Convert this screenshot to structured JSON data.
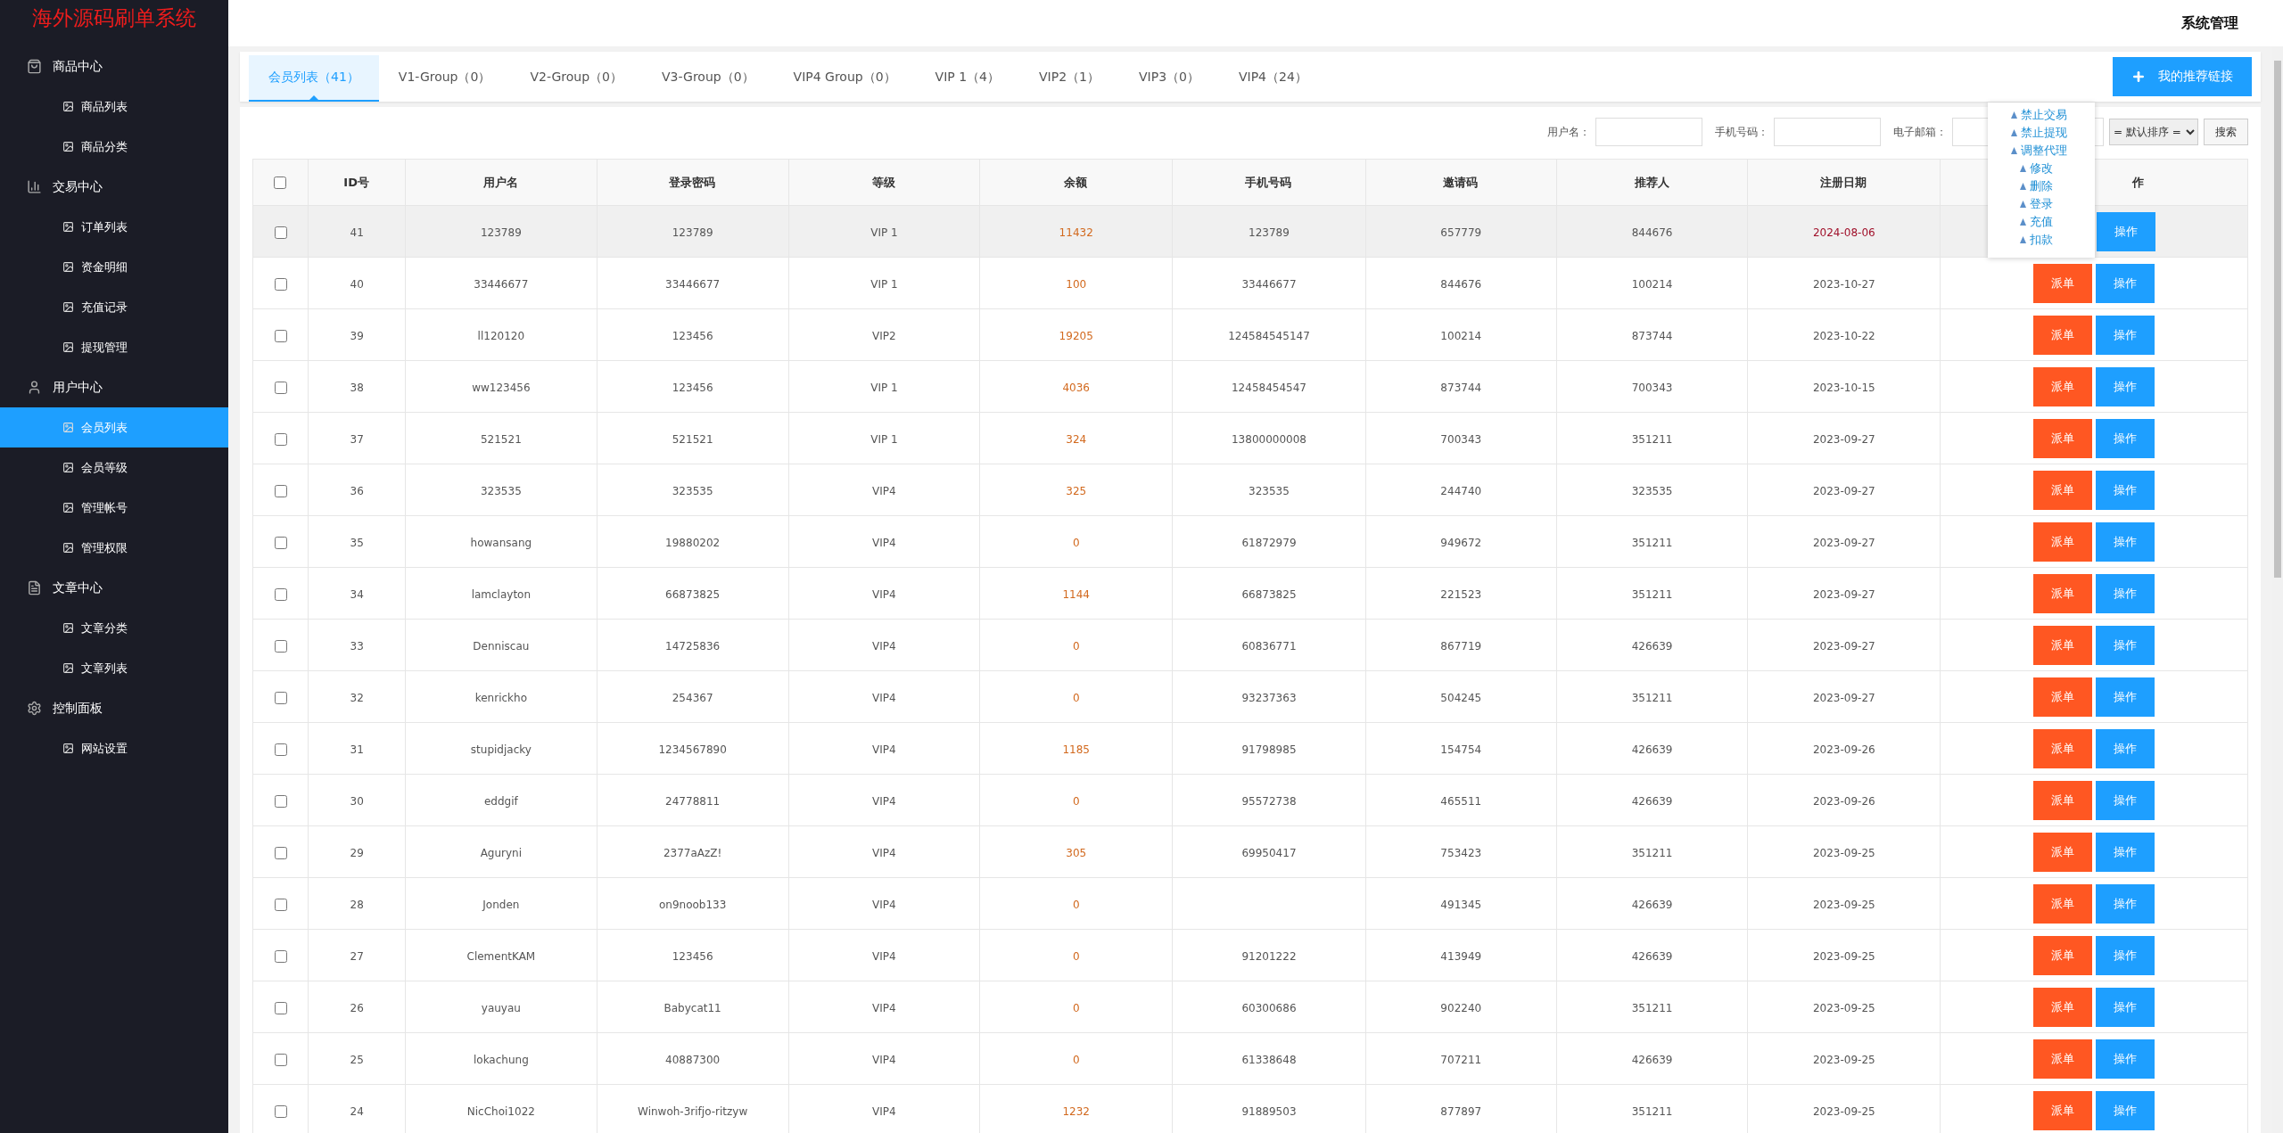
{
  "app_title": "海外源码刷单系统",
  "header": {
    "title": "系统管理"
  },
  "sidebar": {
    "groups": [
      {
        "label": "商品中心",
        "items": [
          {
            "label": "商品列表",
            "selected": false
          },
          {
            "label": "商品分类",
            "selected": false
          }
        ]
      },
      {
        "label": "交易中心",
        "items": [
          {
            "label": "订单列表",
            "selected": false
          },
          {
            "label": "资金明细",
            "selected": false
          },
          {
            "label": "充值记录",
            "selected": false
          },
          {
            "label": "提现管理",
            "selected": false
          }
        ]
      },
      {
        "label": "用户中心",
        "items": [
          {
            "label": "会员列表",
            "selected": true
          },
          {
            "label": "会员等级",
            "selected": false
          },
          {
            "label": "管理帐号",
            "selected": false
          },
          {
            "label": "管理权限",
            "selected": false
          }
        ]
      },
      {
        "label": "文章中心",
        "items": [
          {
            "label": "文章分类",
            "selected": false
          },
          {
            "label": "文章列表",
            "selected": false
          }
        ]
      },
      {
        "label": "控制面板",
        "items": [
          {
            "label": "网站设置",
            "selected": false
          }
        ]
      }
    ]
  },
  "tabs": [
    {
      "label": "会员列表（41）",
      "selected": true
    },
    {
      "label": "V1-Group（0）",
      "selected": false
    },
    {
      "label": "V2-Group（0）",
      "selected": false
    },
    {
      "label": "V3-Group（0）",
      "selected": false
    },
    {
      "label": "VIP4 Group（0）",
      "selected": false
    },
    {
      "label": "VIP 1（4）",
      "selected": false
    },
    {
      "label": "VIP2（1）",
      "selected": false
    },
    {
      "label": "VIP3（0）",
      "selected": false
    },
    {
      "label": "VIP4（24）",
      "selected": false
    }
  ],
  "referral_button": {
    "label": "我的推荐链接"
  },
  "filters": [
    {
      "kind": "text",
      "label": "用户名："
    },
    {
      "kind": "text",
      "label": "手机号码："
    },
    {
      "kind": "text",
      "label": "电子邮箱："
    },
    {
      "kind": "text"
    },
    {
      "kind": "select",
      "value": "= 默认排序 ="
    },
    {
      "kind": "button",
      "label": "搜索"
    }
  ],
  "table": {
    "select_all": {
      "checked": false
    },
    "columns": [
      "ID号",
      "用户名",
      "登录密码",
      "等级",
      "余额",
      "手机号码",
      "邀请码",
      "推荐人",
      "注册日期",
      "作"
    ],
    "rows": [
      {
        "checked": false,
        "hovered": true,
        "flagged": true,
        "cells": [
          "41",
          "123789",
          "123789",
          "VIP 1",
          "11432",
          "123789",
          "657779",
          "844676",
          "2024-08-06"
        ],
        "actions": [
          {
            "kind": "operate",
            "label": "操作"
          }
        ]
      },
      {
        "checked": false,
        "hovered": false,
        "flagged": false,
        "cells": [
          "40",
          "33446677",
          "33446677",
          "VIP 1",
          "100",
          "33446677",
          "844676",
          "100214",
          "2023-10-27"
        ],
        "actions": [
          {
            "kind": "dispatch",
            "label": "派单"
          },
          {
            "kind": "operate",
            "label": "操作"
          }
        ]
      },
      {
        "checked": false,
        "hovered": false,
        "flagged": false,
        "cells": [
          "39",
          "ll120120",
          "123456",
          "VIP2",
          "19205",
          "124584545147",
          "100214",
          "873744",
          "2023-10-22"
        ],
        "actions": [
          {
            "kind": "dispatch",
            "label": "派单"
          },
          {
            "kind": "operate",
            "label": "操作"
          }
        ]
      },
      {
        "checked": false,
        "hovered": false,
        "flagged": false,
        "cells": [
          "38",
          "ww123456",
          "123456",
          "VIP 1",
          "4036",
          "12458454547",
          "873744",
          "700343",
          "2023-10-15"
        ],
        "actions": [
          {
            "kind": "dispatch",
            "label": "派单"
          },
          {
            "kind": "operate",
            "label": "操作"
          }
        ]
      },
      {
        "checked": false,
        "hovered": false,
        "flagged": false,
        "cells": [
          "37",
          "521521",
          "521521",
          "VIP 1",
          "324",
          "13800000008",
          "700343",
          "351211",
          "2023-09-27"
        ],
        "actions": [
          {
            "kind": "dispatch",
            "label": "派单"
          },
          {
            "kind": "operate",
            "label": "操作"
          }
        ]
      },
      {
        "checked": false,
        "hovered": false,
        "flagged": false,
        "cells": [
          "36",
          "323535",
          "323535",
          "VIP4",
          "325",
          "323535",
          "244740",
          "323535",
          "2023-09-27"
        ],
        "actions": [
          {
            "kind": "dispatch",
            "label": "派单"
          },
          {
            "kind": "operate",
            "label": "操作"
          }
        ]
      },
      {
        "checked": false,
        "hovered": false,
        "flagged": false,
        "cells": [
          "35",
          "howansang",
          "19880202",
          "VIP4",
          "0",
          "61872979",
          "949672",
          "351211",
          "2023-09-27"
        ],
        "actions": [
          {
            "kind": "dispatch",
            "label": "派单"
          },
          {
            "kind": "operate",
            "label": "操作"
          }
        ]
      },
      {
        "checked": false,
        "hovered": false,
        "flagged": false,
        "cells": [
          "34",
          "lamclayton",
          "66873825",
          "VIP4",
          "1144",
          "66873825",
          "221523",
          "351211",
          "2023-09-27"
        ],
        "actions": [
          {
            "kind": "dispatch",
            "label": "派单"
          },
          {
            "kind": "operate",
            "label": "操作"
          }
        ]
      },
      {
        "checked": false,
        "hovered": false,
        "flagged": false,
        "cells": [
          "33",
          "Denniscau",
          "14725836",
          "VIP4",
          "0",
          "60836771",
          "867719",
          "426639",
          "2023-09-27"
        ],
        "actions": [
          {
            "kind": "dispatch",
            "label": "派单"
          },
          {
            "kind": "operate",
            "label": "操作"
          }
        ]
      },
      {
        "checked": false,
        "hovered": false,
        "flagged": false,
        "cells": [
          "32",
          "kenrickho",
          "254367",
          "VIP4",
          "0",
          "93237363",
          "504245",
          "351211",
          "2023-09-27"
        ],
        "actions": [
          {
            "kind": "dispatch",
            "label": "派单"
          },
          {
            "kind": "operate",
            "label": "操作"
          }
        ]
      },
      {
        "checked": false,
        "hovered": false,
        "flagged": false,
        "cells": [
          "31",
          "stupidjacky",
          "1234567890",
          "VIP4",
          "1185",
          "91798985",
          "154754",
          "426639",
          "2023-09-26"
        ],
        "actions": [
          {
            "kind": "dispatch",
            "label": "派单"
          },
          {
            "kind": "operate",
            "label": "操作"
          }
        ]
      },
      {
        "checked": false,
        "hovered": false,
        "flagged": false,
        "cells": [
          "30",
          "eddgif",
          "24778811",
          "VIP4",
          "0",
          "95572738",
          "465511",
          "426639",
          "2023-09-26"
        ],
        "actions": [
          {
            "kind": "dispatch",
            "label": "派单"
          },
          {
            "kind": "operate",
            "label": "操作"
          }
        ]
      },
      {
        "checked": false,
        "hovered": false,
        "flagged": false,
        "cells": [
          "29",
          "Aguryni",
          "2377aAzZ!",
          "VIP4",
          "305",
          "69950417",
          "753423",
          "351211",
          "2023-09-25"
        ],
        "actions": [
          {
            "kind": "dispatch",
            "label": "派单"
          },
          {
            "kind": "operate",
            "label": "操作"
          }
        ]
      },
      {
        "checked": false,
        "hovered": false,
        "flagged": false,
        "cells": [
          "28",
          "Jonden",
          "on9noob133",
          "VIP4",
          "0",
          null,
          "491345",
          "426639",
          "2023-09-25"
        ],
        "actions": [
          {
            "kind": "dispatch",
            "label": "派单"
          },
          {
            "kind": "operate",
            "label": "操作"
          }
        ]
      },
      {
        "checked": false,
        "hovered": false,
        "flagged": false,
        "cells": [
          "27",
          "ClementKAM",
          "123456",
          "VIP4",
          "0",
          "91201222",
          "413949",
          "426639",
          "2023-09-25"
        ],
        "actions": [
          {
            "kind": "dispatch",
            "label": "派单"
          },
          {
            "kind": "operate",
            "label": "操作"
          }
        ]
      },
      {
        "checked": false,
        "hovered": false,
        "flagged": false,
        "cells": [
          "26",
          "yauyau",
          "Babycat11",
          "VIP4",
          "0",
          "60300686",
          "902240",
          "351211",
          "2023-09-25"
        ],
        "actions": [
          {
            "kind": "dispatch",
            "label": "派单"
          },
          {
            "kind": "operate",
            "label": "操作"
          }
        ]
      },
      {
        "checked": false,
        "hovered": false,
        "flagged": false,
        "cells": [
          "25",
          "lokachung",
          "40887300",
          "VIP4",
          "0",
          "61338648",
          "707211",
          "426639",
          "2023-09-25"
        ],
        "actions": [
          {
            "kind": "dispatch",
            "label": "派单"
          },
          {
            "kind": "operate",
            "label": "操作"
          }
        ]
      },
      {
        "checked": false,
        "hovered": false,
        "flagged": false,
        "cells": [
          "24",
          "NicChoi1022",
          "Winwoh-3rifjo-ritzyw",
          "VIP4",
          "1232",
          "91889503",
          "877897",
          "351211",
          "2023-09-25"
        ],
        "actions": [
          {
            "kind": "dispatch",
            "label": "派单"
          },
          {
            "kind": "operate",
            "label": "操作"
          }
        ]
      }
    ]
  },
  "action_menu": {
    "items": [
      {
        "label": "禁止交易"
      },
      {
        "label": "禁止提现"
      },
      {
        "label": "调整代理",
        "children": [
          {
            "label": "修改"
          },
          {
            "label": "删除"
          },
          {
            "label": "登录"
          },
          {
            "label": "充值"
          },
          {
            "label": "扣款"
          }
        ]
      }
    ]
  }
}
